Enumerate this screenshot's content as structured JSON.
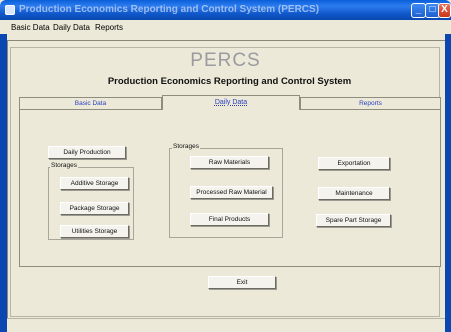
{
  "window": {
    "title": "Production Economics Reporting and Control System (PERCS)",
    "buttons": {
      "minimize": "_",
      "maximize": "□",
      "close": "X"
    }
  },
  "menu": [
    "Basic Data",
    "Daily Data",
    "Reports"
  ],
  "header": {
    "logo_text": "PERCS",
    "subtitle": "Production Economics Reporting and Control System"
  },
  "tabs": [
    {
      "label": "Basic Data",
      "active": false
    },
    {
      "label": "Daily Data",
      "active": true
    },
    {
      "label": "Reports",
      "active": false
    }
  ],
  "daily_data": {
    "daily_production_label": "Daily Production",
    "left_group": {
      "title": "Storages",
      "buttons": [
        "Additive Storage",
        "Package Storage",
        "Utilities Storage"
      ]
    },
    "middle_group": {
      "title": "Storages",
      "buttons": [
        "Raw Materials",
        "Processed Raw Material",
        "Final Products"
      ]
    },
    "right_buttons": [
      "Exportation",
      "Maintenance",
      "Spare Part Storage"
    ]
  },
  "footer": {
    "exit_label": "Exit"
  },
  "colors": {
    "titlebar": "#0a5fd8",
    "background": "#ece9d8",
    "tab_text": "#2a3fbf"
  }
}
